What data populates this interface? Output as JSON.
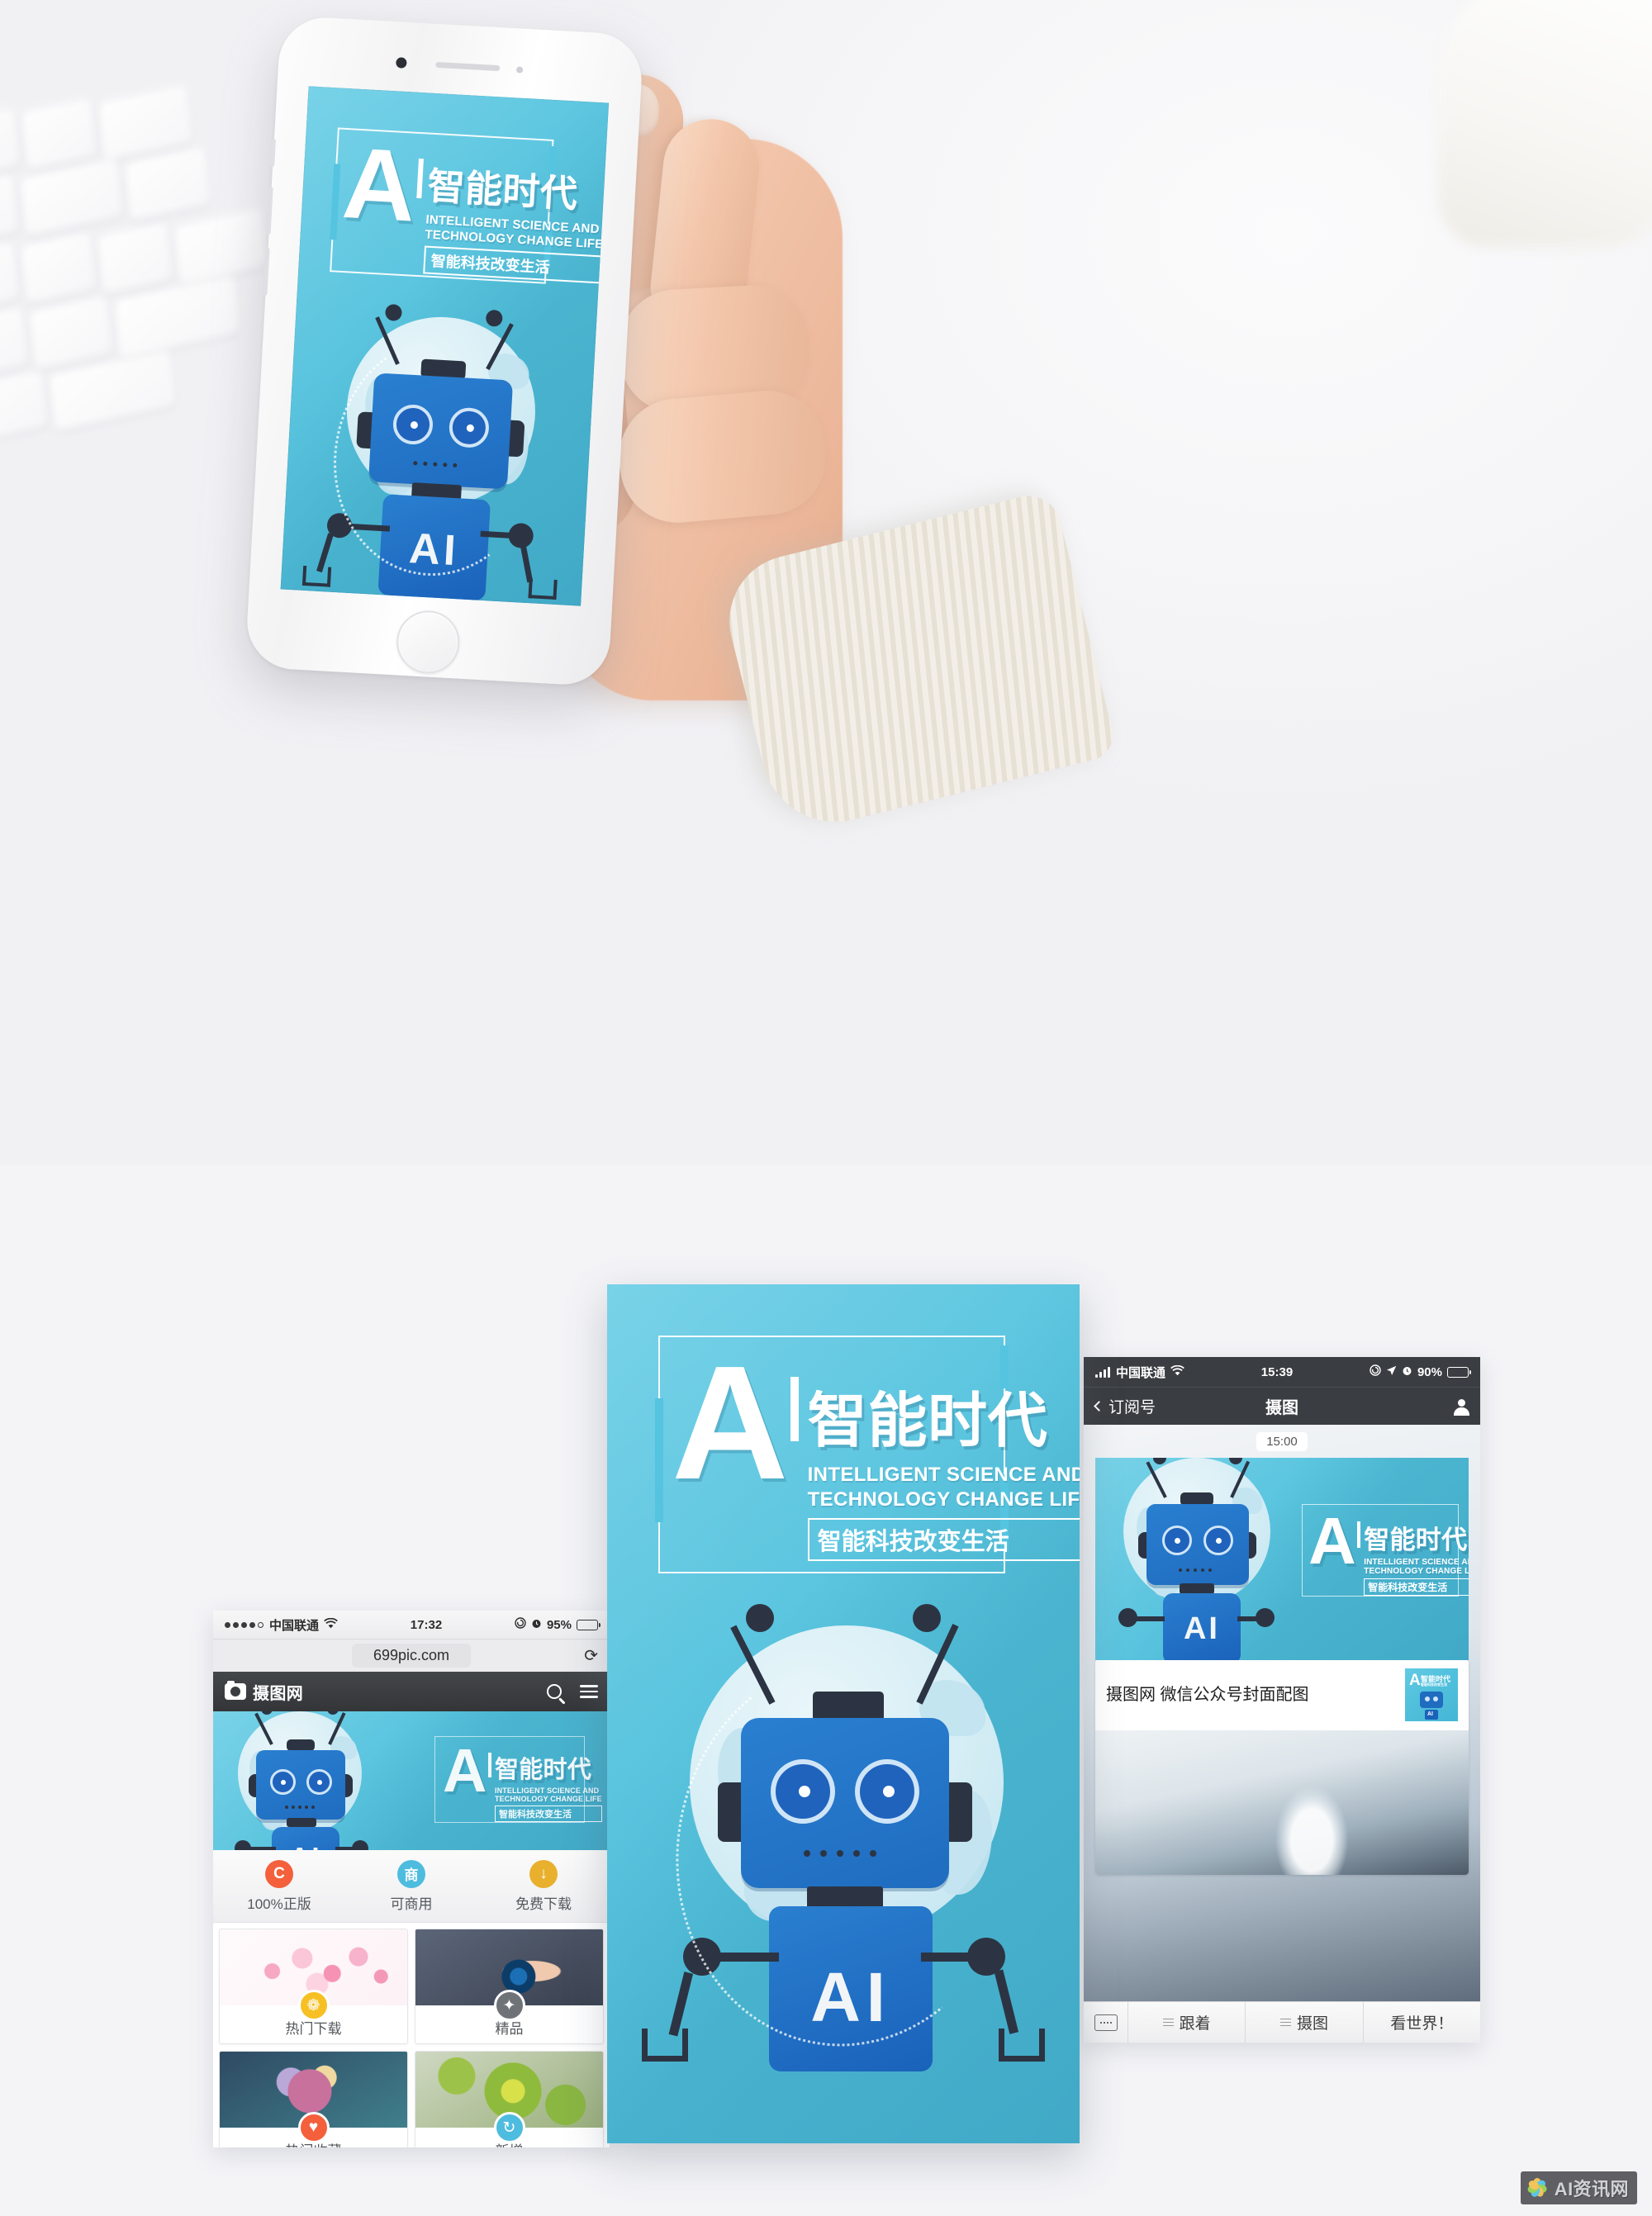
{
  "poster": {
    "logo_letter": "A",
    "divider": "I",
    "cn_title": "智能时代",
    "en_line1": "INTELLIGENT SCIENCE AND",
    "en_line2": "TECHNOLOGY CHANGE LIFE",
    "sub_badge": "智能科技改变生活",
    "robot_chest_label": "AI",
    "bg_color": "#50c0dc",
    "robot_blue": "#2a7fd0",
    "robot_dark": "#2c3443"
  },
  "left_phone": {
    "status": {
      "carrier": "中国联通",
      "time": "17:32",
      "battery_percent": "95%",
      "wifi_icon": "wifi-icon",
      "lock_icon": "rotation-lock-icon",
      "alarm_icon": "alarm-icon"
    },
    "browser": {
      "url": "699pic.com",
      "reload_icon": "reload-icon"
    },
    "site_header": {
      "logo_icon": "camera-icon",
      "name": "摄图网",
      "search_icon": "search-icon",
      "menu_icon": "hamburger-menu-icon"
    },
    "features": [
      {
        "label": "100%正版",
        "icon": "copyright-icon",
        "glyph": "C",
        "color": "#f4603c"
      },
      {
        "label": "可商用",
        "icon": "commercial-icon",
        "glyph": "商",
        "color": "#4ebcdf"
      },
      {
        "label": "免费下载",
        "icon": "download-icon",
        "glyph": "↓",
        "color": "#e9b02e"
      }
    ],
    "cards": [
      {
        "label": "热门下载",
        "icon": "fire-icon",
        "glyph": "🔥",
        "badge_color": "#f6c025",
        "image": "sakura-blossoms"
      },
      {
        "label": "精品",
        "icon": "medal-icon",
        "glyph": "✦",
        "badge_color": "#6f7378",
        "image": "hand-holding-remote"
      },
      {
        "label": "热门收藏",
        "icon": "heart-icon",
        "glyph": "♥",
        "badge_color": "#f4603c",
        "image": "purple-rose"
      },
      {
        "label": "新增",
        "icon": "refresh-icon",
        "glyph": "↻",
        "badge_color": "#4ebcdf",
        "image": "green-sunflower"
      }
    ]
  },
  "right_phone": {
    "status": {
      "carrier": "中国联通",
      "time": "15:39",
      "battery_percent": "90%",
      "signal_icon": "signal-bars-icon",
      "wifi_icon": "wifi-icon",
      "location_icon": "location-arrow-icon",
      "lock_icon": "rotation-lock-icon",
      "alarm_icon": "alarm-icon"
    },
    "nav": {
      "back_label": "订阅号",
      "title": "摄图",
      "profile_icon": "person-icon"
    },
    "chat": {
      "timestamp": "15:00",
      "article_title": "摄图网 微信公众号封面配图",
      "thumbnail_icon": "ai-poster-thumbnail"
    },
    "toolbar": {
      "keyboard_icon": "keyboard-icon",
      "items": [
        {
          "label": "跟着",
          "icon": "list-icon"
        },
        {
          "label": "摄图",
          "icon": "list-icon"
        },
        {
          "label": "看世界！",
          "icon": ""
        }
      ]
    }
  },
  "watermark": {
    "text": "AI资讯网",
    "logo_icon": "flower-logo-icon"
  }
}
